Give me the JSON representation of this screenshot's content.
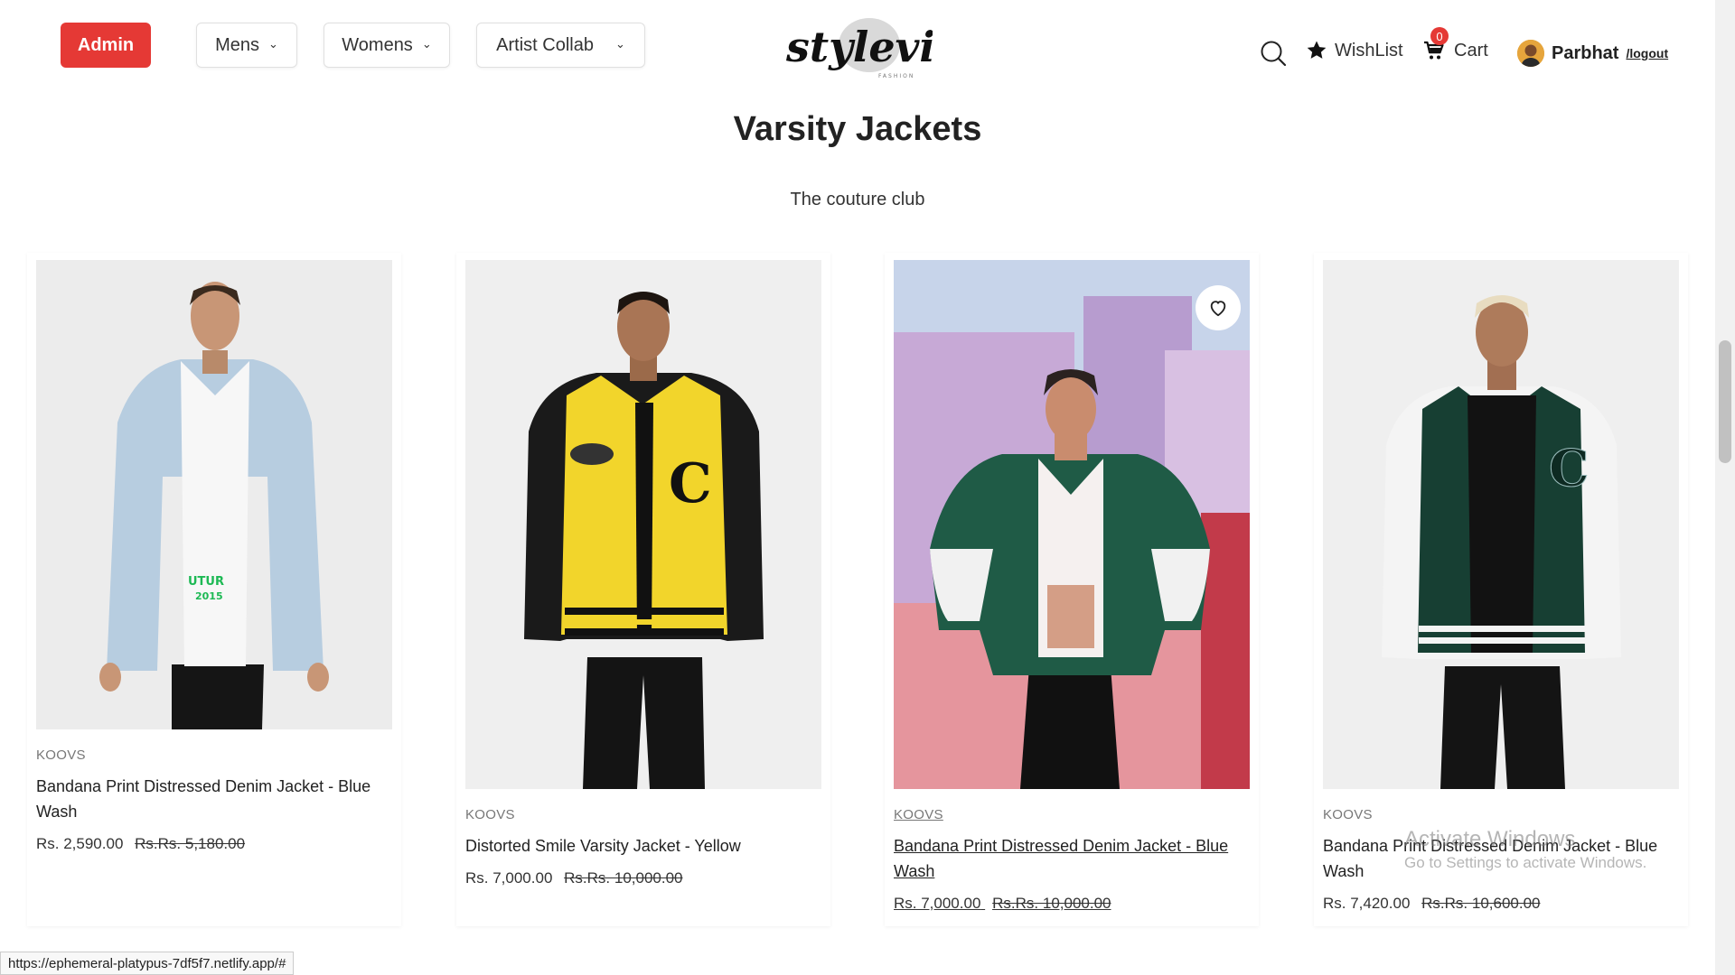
{
  "header": {
    "admin_label": "Admin",
    "nav": [
      {
        "label": "Mens"
      },
      {
        "label": "Womens"
      },
      {
        "label": "Artist Collab"
      }
    ],
    "logo_text": "stylevibe",
    "logo_subtext": "FASHION",
    "wishlist_label": "WishList",
    "cart_label": "Cart",
    "cart_count": "0",
    "username": "Parbhat",
    "logout_label": "/logout",
    "accent_color": "#e53935"
  },
  "section": {
    "title": "Varsity Jackets",
    "subtitle": "The couture club"
  },
  "products": [
    {
      "brand": "KOOVS",
      "name": "Bandana Print Distressed Denim Jacket - Blue Wash",
      "price": "Rs. 2,590.00",
      "old_price": "Rs.Rs. 5,180.00"
    },
    {
      "brand": "KOOVS",
      "name": "Distorted Smile Varsity Jacket - Yellow",
      "price": "Rs. 7,000.00",
      "old_price": "Rs.Rs. 10,000.00"
    },
    {
      "brand": "KOOVS",
      "name": "Bandana Print Distressed Denim Jacket - Blue Wash",
      "price": "Rs. 7,000.00",
      "old_price": "Rs.Rs. 10,000.00"
    },
    {
      "brand": "KOOVS",
      "name": "Bandana Print Distressed Denim Jacket - Blue Wash",
      "price": "Rs. 7,420.00",
      "old_price": "Rs.Rs. 10,600.00"
    }
  ],
  "status_url": "https://ephemeral-platypus-7df5f7.netlify.app/#",
  "watermark": {
    "line1": "Activate Windows",
    "line2": "Go to Settings to activate Windows."
  }
}
